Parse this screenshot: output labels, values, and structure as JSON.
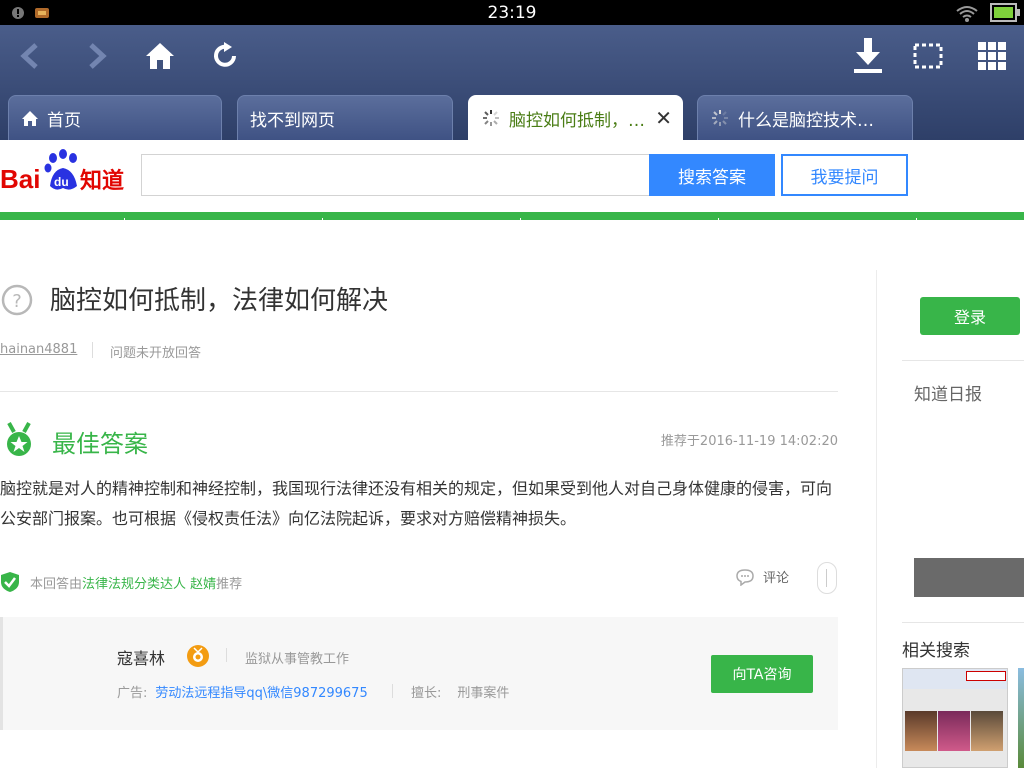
{
  "status_bar": {
    "time": "23:19"
  },
  "browser": {
    "tabs": [
      {
        "label": "首页",
        "icon": "home-icon"
      },
      {
        "label": "找不到网页",
        "icon": ""
      },
      {
        "label": "脑控如何抵制，…",
        "icon": "loading-spinner-icon",
        "active": true
      },
      {
        "label": "什么是脑控技术…",
        "icon": "loading-spinner-icon"
      }
    ],
    "toolbar_icons": [
      "back-icon",
      "forward-icon",
      "home-icon",
      "refresh-icon",
      "download-icon",
      "screenshot-icon",
      "grid-menu-icon"
    ]
  },
  "header": {
    "logo_text": "Bai du 知道",
    "search_placeholder": "",
    "search_button": "搜索答案",
    "ask_button": "我要提问"
  },
  "question": {
    "title": "脑控如何抵制，法律如何解决",
    "user": "hainan4881",
    "status": "问题未开放回答"
  },
  "best_answer": {
    "title": "最佳答案",
    "time": "推荐于2016-11-19  14:02:20",
    "text": "脑控就是对人的精神控制和神经控制，我国现行法律还没有相关的规定，但如果受到他人对自己身体健康的侵害，可向公安部门报案。也可根据《侵权责任法》向亿法院起诉，要求对方赔偿精神损失。",
    "recommend_prefix": "本回答由",
    "recommend_who": "法律法规分类达人  赵婧",
    "recommend_suffix": "推荐",
    "comment_label": "评论"
  },
  "expert_card": {
    "name": "寇喜林",
    "job": "监狱从事管教工作",
    "ad_prefix": "广告:",
    "ad_link": "劳动法远程指导qq\\微信987299675",
    "skill_label": "擅长:",
    "skill_value": "刑事案件",
    "consult_button": "向TA咨询"
  },
  "sidebar": {
    "login_button": "登录",
    "daily_title": "知道日报",
    "related_title": "相关搜索"
  },
  "colors": {
    "accent_green": "#38b549",
    "accent_blue": "#3388ff",
    "chrome_blue": "#3f5284"
  }
}
